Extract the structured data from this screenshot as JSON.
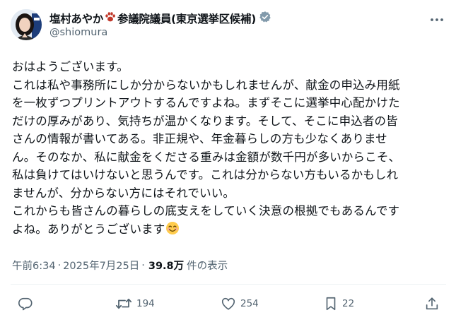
{
  "author": {
    "display_name": "塩村あやか",
    "title_suffix": "参議院議員(東京選挙区候補)",
    "handle": "@shiomura",
    "verified": true
  },
  "tweet": {
    "lines": [
      "おはようございます。",
      "これは私や事務所にしか分からないかもしれませんが、献金の申込み用紙",
      "を一枚ずつプリントアウトするんですよね。まずそこに選挙中心配かけた",
      "だけの厚みがあり、気持ちが温かくなります。そして、そこに申込者の皆",
      "さんの情報が書いてある。非正規や、年金暮らしの方も少なくありませ",
      "ん。そのなか、私に献金をくださる重みは金額が数千円が多いからこそ、",
      "私は負けてはいけないと思うんです。これは分からない方もいるかもしれ",
      "ませんが、分からない方にはそれでいい。",
      "これからも皆さんの暮らしの底支えをしていく決意の根拠でもあるんです",
      "よね。ありがとうございます"
    ],
    "emoji": "smiling-face-emoji"
  },
  "meta": {
    "time": "午前6:34",
    "separator": "·",
    "date": "2025年7月25日",
    "views_count": "39.8万",
    "views_label": "件の表示"
  },
  "actions": {
    "reply_count": "",
    "retweet_count": "194",
    "like_count": "254",
    "bookmark_count": "22"
  },
  "colors": {
    "text": "#0f1419",
    "secondary": "#536471",
    "verified_badge": "#829aab",
    "divider": "#eff3f4",
    "paw": "#c0392b"
  }
}
